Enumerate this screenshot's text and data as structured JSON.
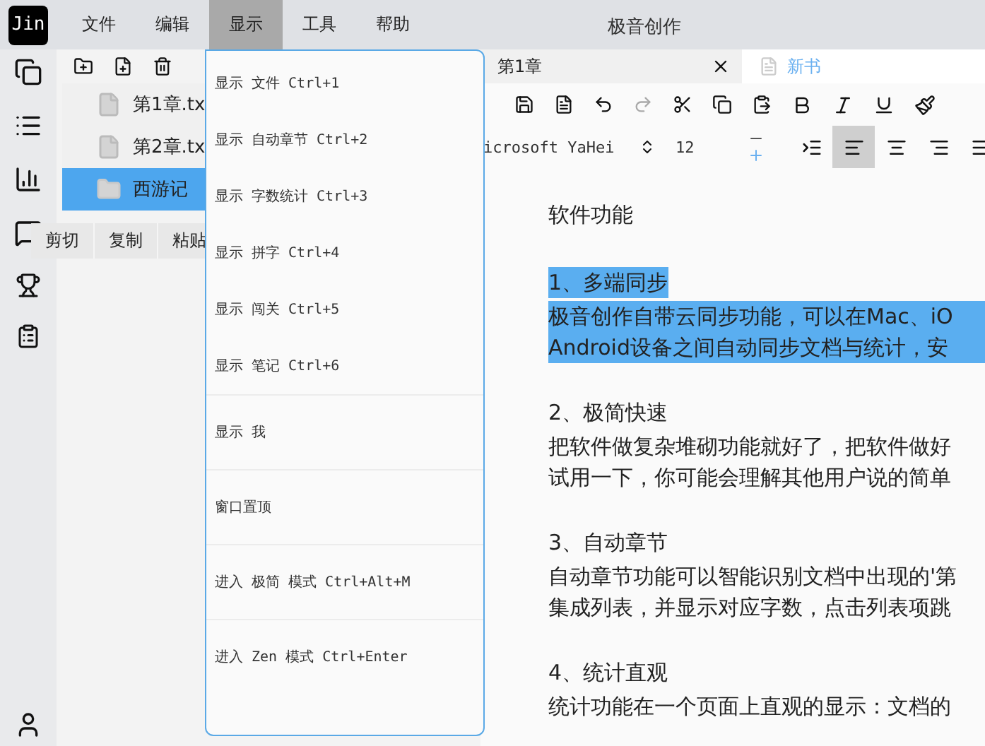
{
  "menubar": {
    "logo": "Jin",
    "title": "极音创作",
    "items": [
      {
        "label": "文件",
        "selected": false
      },
      {
        "label": "编辑",
        "selected": false
      },
      {
        "label": "显示",
        "selected": true
      },
      {
        "label": "工具",
        "selected": false
      },
      {
        "label": "帮助",
        "selected": false
      }
    ]
  },
  "files": {
    "items": [
      {
        "name": "第1章.tx",
        "kind": "file",
        "selected": false
      },
      {
        "name": "第2章.tx",
        "kind": "file",
        "selected": false
      },
      {
        "name": "西游记",
        "kind": "folder",
        "selected": true
      }
    ]
  },
  "clipboard_bar": [
    "剪切",
    "复制",
    "粘贴"
  ],
  "menu": {
    "groups": [
      [
        "显示 文件 Ctrl+1",
        "显示 自动章节 Ctrl+2",
        "显示 字数统计 Ctrl+3",
        "显示 拼字 Ctrl+4",
        "显示 闯关 Ctrl+5",
        "显示 笔记 Ctrl+6"
      ],
      [
        "显示 我"
      ],
      [
        "窗口置顶"
      ],
      [
        "进入 极简 模式 Ctrl+Alt+M"
      ],
      [
        "进入 Zen 模式 Ctrl+Enter"
      ]
    ]
  },
  "tabs": [
    {
      "label": "第1章",
      "selected": false,
      "closable": true
    },
    {
      "label": "新书",
      "selected": true,
      "closable": false
    }
  ],
  "toolbar": {
    "redo_disabled": true
  },
  "format": {
    "font": "icrosoft YaHei",
    "size": "12",
    "alignments": [
      {
        "kind": "indent",
        "selected": false
      },
      {
        "kind": "left",
        "selected": true
      },
      {
        "kind": "center",
        "selected": false
      },
      {
        "kind": "right",
        "selected": false
      },
      {
        "kind": "justify",
        "selected": false
      }
    ]
  },
  "document": {
    "title": "软件功能",
    "sections": [
      {
        "heading": "1、多端同步",
        "highlighted": true,
        "lines": [
          "极音创作自带云同步功能，可以在Mac、iO",
          "Android设备之间自动同步文档与统计，安"
        ]
      },
      {
        "heading": "2、极简快速",
        "highlighted": false,
        "lines": [
          "把软件做复杂堆砌功能就好了，把软件做好",
          "试用一下，你可能会理解其他用户说的简单"
        ]
      },
      {
        "heading": "3、自动章节",
        "highlighted": false,
        "lines": [
          "自动章节功能可以智能识别文档中出现的'第",
          "集成列表，并显示对应字数，点击列表项跳"
        ]
      },
      {
        "heading": "4、统计直观",
        "highlighted": false,
        "lines": [
          "统计功能在一个页面上直观的显示：文档的"
        ]
      }
    ]
  }
}
